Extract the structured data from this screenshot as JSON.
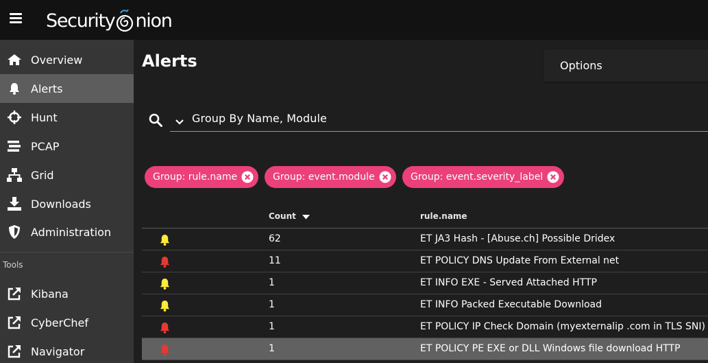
{
  "app": {
    "logo_text_1": "Security",
    "logo_text_2": "nion",
    "brand_accent": "#3a9ee0"
  },
  "sidebar": {
    "items": [
      {
        "label": "Overview",
        "icon": "home-icon"
      },
      {
        "label": "Alerts",
        "icon": "bell-icon",
        "active": true
      },
      {
        "label": "Hunt",
        "icon": "crosshairs-icon"
      },
      {
        "label": "PCAP",
        "icon": "stream-icon"
      },
      {
        "label": "Grid",
        "icon": "sitemap-icon"
      },
      {
        "label": "Downloads",
        "icon": "download-icon"
      },
      {
        "label": "Administration",
        "icon": "shield-icon"
      }
    ],
    "tools_label": "Tools",
    "tools": [
      {
        "label": "Kibana",
        "icon": "external-link-icon"
      },
      {
        "label": "CyberChef",
        "icon": "external-link-icon"
      },
      {
        "label": "Navigator",
        "icon": "external-link-icon"
      }
    ]
  },
  "main": {
    "title": "Alerts",
    "options_label": "Options",
    "query": "Group By Name, Module",
    "chips": [
      "Group: rule.name",
      "Group: event.module",
      "Group: event.severity_label"
    ],
    "chip_color": "#ec407a"
  },
  "table": {
    "headers": {
      "count": "Count",
      "rule": "rule.name"
    },
    "sort_icon": "sort-desc-icon",
    "severity_colors": {
      "medium": "#ffeb3b",
      "high": "#e53935"
    },
    "rows": [
      {
        "severity": "medium",
        "count": "62",
        "rule": "ET JA3 Hash - [Abuse.ch] Possible Dridex"
      },
      {
        "severity": "high",
        "count": "11",
        "rule": "ET POLICY DNS Update From External net"
      },
      {
        "severity": "medium",
        "count": "1",
        "rule": "ET INFO EXE - Served Attached HTTP"
      },
      {
        "severity": "medium",
        "count": "1",
        "rule": "ET INFO Packed Executable Download"
      },
      {
        "severity": "high",
        "count": "1",
        "rule": "ET POLICY IP Check Domain (myexternalip .com in TLS SNI)"
      },
      {
        "severity": "high",
        "count": "1",
        "rule": "ET POLICY PE EXE or DLL Windows file download HTTP",
        "selected": true
      }
    ]
  }
}
